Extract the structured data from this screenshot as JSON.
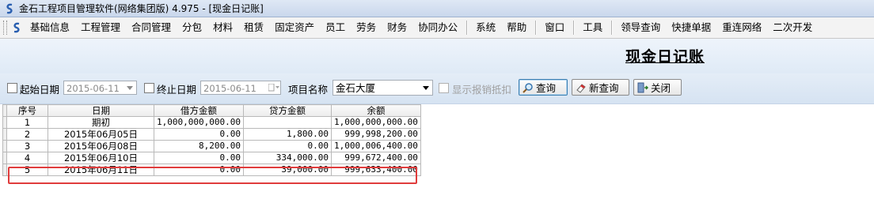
{
  "window": {
    "title": "金石工程项目管理软件(网络集团版) 4.975 - [现金日记账]"
  },
  "menu": {
    "items": [
      "基础信息",
      "工程管理",
      "合同管理",
      "分包",
      "材料",
      "租赁",
      "固定资产",
      "员工",
      "劳务",
      "财务",
      "协同办公",
      "系统",
      "帮助",
      "窗口",
      "工具",
      "领导查询",
      "快捷单据",
      "重连网络",
      "二次开发"
    ]
  },
  "report": {
    "title": "现金日记账"
  },
  "filters": {
    "start_date_label": "起始日期",
    "start_date_value": "2015-06-11",
    "end_date_label": "终止日期",
    "end_date_value": "2015-06-11",
    "project_label": "项目名称",
    "project_value": "金石大厦",
    "show_reimburse_label": "显示报销抵扣",
    "query_button": "查询",
    "new_query_button": "新查询",
    "close_button": "关闭"
  },
  "table": {
    "columns": [
      "序号",
      "日期",
      "借方金额",
      "贷方金额",
      "余额"
    ],
    "rows": [
      [
        "1",
        "期初",
        "1,000,000,000.00",
        "",
        "1,000,000,000.00"
      ],
      [
        "2",
        "2015年06月05日",
        "0.00",
        "1,800.00",
        "999,998,200.00"
      ],
      [
        "3",
        "2015年06月08日",
        "8,200.00",
        "0.00",
        "1,000,006,400.00"
      ],
      [
        "4",
        "2015年06月10日",
        "0.00",
        "334,000.00",
        "999,672,400.00"
      ],
      [
        "5",
        "2015年06月11日",
        "0.00",
        "39,000.00",
        "999,633,400.00"
      ]
    ]
  },
  "colors": {
    "highlight": "#e03c3c",
    "app_icon": "#2a5fb0"
  },
  "icons": {
    "app": "app-logo-icon",
    "dropdown": "chevron-down-icon",
    "query": "magnifier-icon",
    "new_query": "eraser-icon",
    "close": "door-exit-icon"
  }
}
